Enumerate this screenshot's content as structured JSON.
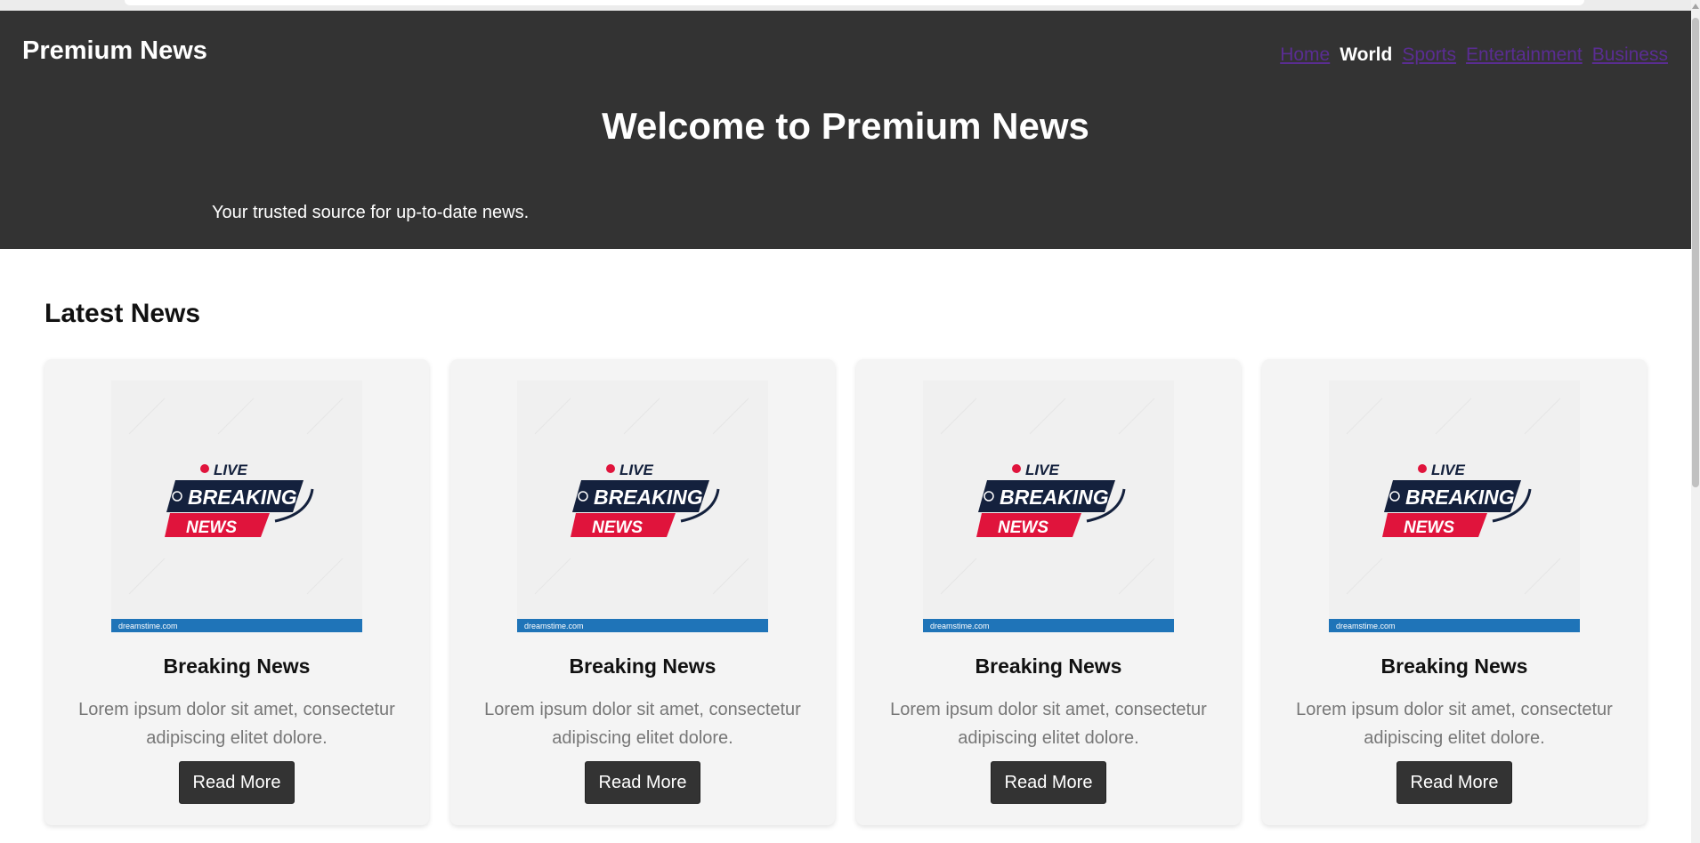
{
  "header": {
    "logo": "Premium News",
    "nav": [
      {
        "label": "Home",
        "active": false
      },
      {
        "label": "World",
        "active": true
      },
      {
        "label": "Sports",
        "active": false
      },
      {
        "label": "Entertainment",
        "active": false
      },
      {
        "label": "Business",
        "active": false
      }
    ],
    "hero_title": "Welcome to Premium News",
    "hero_subtitle": "Your trusted source for up-to-date news."
  },
  "main": {
    "section_title": "Latest News",
    "cards": [
      {
        "image_live_text": "LIVE",
        "image_breaking_text": "BREAKING",
        "image_news_text": "NEWS",
        "image_footer_text": "dreamstime.com",
        "title": "Breaking News",
        "text": "Lorem ipsum dolor sit amet, consectetur adipiscing elitet dolore.",
        "button": "Read More"
      },
      {
        "image_live_text": "LIVE",
        "image_breaking_text": "BREAKING",
        "image_news_text": "NEWS",
        "image_footer_text": "dreamstime.com",
        "title": "Breaking News",
        "text": "Lorem ipsum dolor sit amet, consectetur adipiscing elitet dolore.",
        "button": "Read More"
      },
      {
        "image_live_text": "LIVE",
        "image_breaking_text": "BREAKING",
        "image_news_text": "NEWS",
        "image_footer_text": "dreamstime.com",
        "title": "Breaking News",
        "text": "Lorem ipsum dolor sit amet, consectetur adipiscing elitet dolore.",
        "button": "Read More"
      },
      {
        "image_live_text": "LIVE",
        "image_breaking_text": "BREAKING",
        "image_news_text": "NEWS",
        "image_footer_text": "dreamstime.com",
        "title": "Breaking News",
        "text": "Lorem ipsum dolor sit amet, consectetur adipiscing elitet dolore.",
        "button": "Read More"
      }
    ]
  },
  "colors": {
    "header_bg": "#333333",
    "visited_link": "#5a2d92",
    "card_bg": "#f4f4f4",
    "button_bg": "#333333",
    "breaking_navy": "#14213d",
    "breaking_red": "#e0143c",
    "image_footer_blue": "#1f74b8"
  }
}
